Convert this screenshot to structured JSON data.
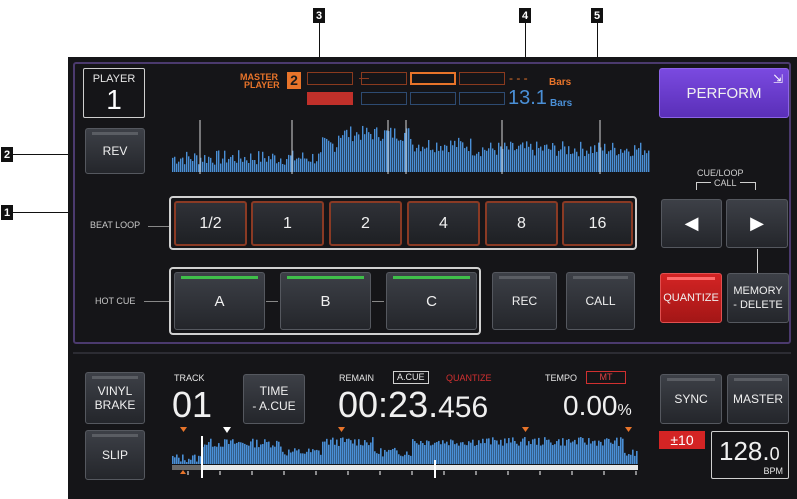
{
  "callouts": [
    "1",
    "2",
    "3",
    "4",
    "5"
  ],
  "player": {
    "label": "PLAYER",
    "number": "1"
  },
  "master": {
    "label_line1": "MASTER",
    "label_line2": "PLAYER",
    "number": "2"
  },
  "bars": {
    "count": "13.1",
    "label": "Bars",
    "dash_label": "- - -",
    "label_top": "Bars"
  },
  "buttons": {
    "rev": "REV",
    "perform": "PERFORM",
    "cue_loop_call_title": "CUE/LOOP",
    "cue_loop_call_sub": "CALL",
    "quantize": "QUANTIZE",
    "memory_line1": "MEMORY",
    "memory_line2": "- DELETE",
    "rec": "REC",
    "call": "CALL",
    "vinyl_line1": "VINYL",
    "vinyl_line2": "BRAKE",
    "slip": "SLIP",
    "time_line1": "TIME",
    "time_line2": "- A.CUE",
    "sync": "SYNC",
    "master": "MASTER"
  },
  "beat_loop": {
    "label": "BEAT LOOP",
    "values": [
      "1/2",
      "1",
      "2",
      "4",
      "8",
      "16"
    ]
  },
  "hot_cue": {
    "label": "HOT CUE",
    "values": [
      "A",
      "B",
      "C"
    ]
  },
  "track": {
    "label": "TRACK",
    "number": "01"
  },
  "remain": {
    "label": "REMAIN",
    "acue": "A.CUE",
    "quantize": "QUANTIZE",
    "time_main": "00:23.",
    "time_frac": "456"
  },
  "tempo": {
    "label": "TEMPO",
    "mt": "MT",
    "value": "0.00",
    "unit": "%",
    "range": "±10"
  },
  "bpm": {
    "value": "128.",
    "decimal": "0",
    "unit": "BPM"
  },
  "colors": {
    "accent_purple": "#6a3bd0",
    "loop_border": "#8a3a24",
    "hotcue_green": "#3fbf4a",
    "quantize_red": "#c81d1d",
    "waveform": "#4a8fd6",
    "orange": "#e8742a"
  }
}
